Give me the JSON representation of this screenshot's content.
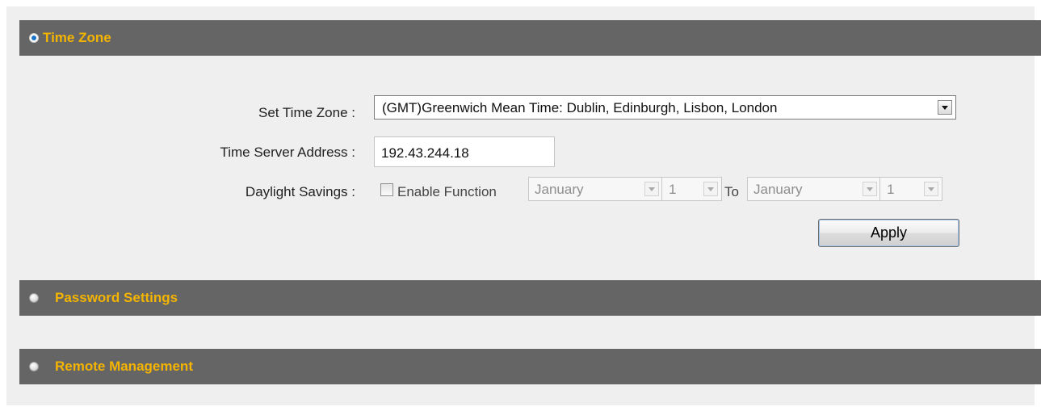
{
  "sections": [
    {
      "title": "Time Zone",
      "expanded": true
    },
    {
      "title": "Password Settings",
      "expanded": false
    },
    {
      "title": "Remote Management",
      "expanded": false
    }
  ],
  "time_zone": {
    "set_time_zone_label": "Set Time Zone :",
    "set_time_zone_value": "(GMT)Greenwich Mean Time: Dublin, Edinburgh, Lisbon, London",
    "time_server_label": "Time Server Address :",
    "time_server_value": "192.43.244.18",
    "daylight_label": "Daylight Savings :",
    "daylight": {
      "enable_label": "Enable Function",
      "enabled": false,
      "start_month": "January",
      "start_day": "1",
      "to_label": "To",
      "end_month": "January",
      "end_day": "1"
    },
    "apply_label": "Apply"
  },
  "colors": {
    "header_bg": "#656565",
    "header_text": "#f4b400",
    "panel_bg": "#efefef",
    "radio_active": "#1a73c8"
  },
  "icons": {
    "active_section": "radio-selected-icon",
    "inactive_section": "radio-unselected-icon",
    "dropdown": "chevron-down-icon"
  }
}
